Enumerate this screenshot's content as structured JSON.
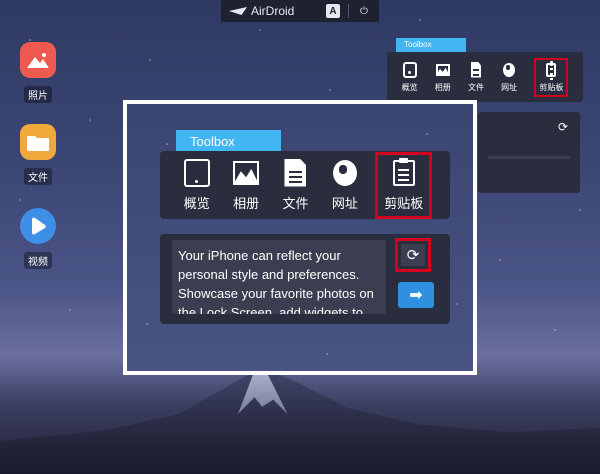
{
  "topbar": {
    "app_name": "AirDroid",
    "a_button": "A",
    "power_icon": "⏻"
  },
  "desktop": {
    "items": [
      {
        "label": "照片",
        "icon": "photos-icon",
        "color": "#ee5a4f"
      },
      {
        "label": "文件",
        "icon": "folder-icon",
        "color": "#f2a93b"
      },
      {
        "label": "视频",
        "icon": "video-icon",
        "color": "#3e8fe8"
      }
    ]
  },
  "toolbox": {
    "tab_label": "Toolbox",
    "tools": [
      {
        "label": "概览",
        "icon": "phone-icon"
      },
      {
        "label": "相册",
        "icon": "image-icon"
      },
      {
        "label": "文件",
        "icon": "document-icon"
      },
      {
        "label": "网址",
        "icon": "globe-icon"
      },
      {
        "label": "剪贴板",
        "icon": "clipboard-icon",
        "highlighted": true
      }
    ]
  },
  "clipboard_card": {
    "text": "Your iPhone can reflect your personal style and preferences. Showcase your favorite photos on the Lock Screen, add widgets to",
    "refresh_icon": "⟳",
    "send_icon": "➡"
  },
  "colors": {
    "accent": "#41b6f2",
    "highlight": "#d4001f",
    "send_button": "#2f8fe0"
  }
}
